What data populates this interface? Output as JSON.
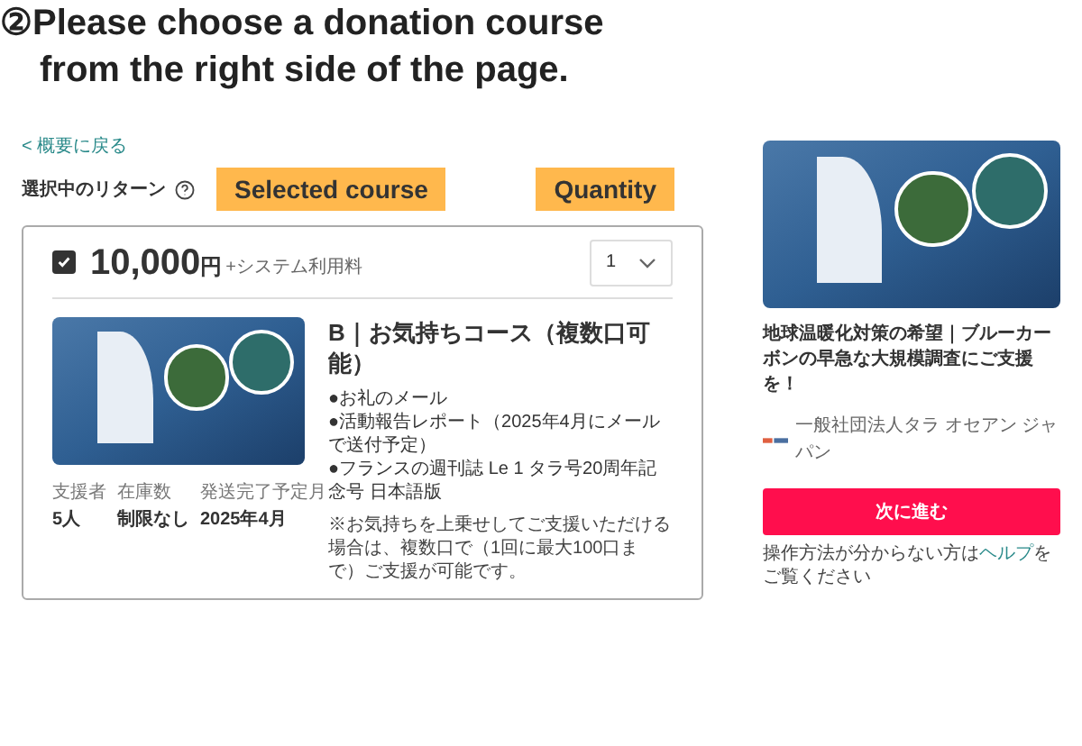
{
  "instruction": "②Please choose a donation course from the right side of the page.",
  "back_link": "< 概要に戻る",
  "selected_return_label": "選択中のリターン",
  "annotations": [
    "Selected course",
    "Quantity"
  ],
  "course": {
    "checked": true,
    "price": "10,000",
    "currency": "円",
    "fee_note": "+システム利用料",
    "quantity": "1",
    "title": "B｜お気持ちコース（複数口可能）",
    "stats": [
      {
        "label": "支援者",
        "value": "5人"
      },
      {
        "label": "在庫数",
        "value": "制限なし"
      },
      {
        "label": "発送完了予定月",
        "value": "2025年4月"
      }
    ],
    "items": [
      "●お礼のメール",
      "●活動報告レポート（2025年4月にメールで送付予定）",
      "●フランスの週刊誌 Le 1 タラ号20周年記念号 日本語版"
    ],
    "note": "※お気持ちを上乗せしてご支援いただける場合は、複数口で（1回に最大100口まで）ご支援が可能です。"
  },
  "project": {
    "title": "地球温暖化対策の希望｜ブルーカーボンの早急な大規模調査にご支援を！",
    "organization": "一般社団法人タラ オセアン ジャパン"
  },
  "next_button": "次に進む",
  "help": {
    "before": "操作方法が分からない方は",
    "link": "ヘルプ",
    "after": "をご覧ください"
  }
}
